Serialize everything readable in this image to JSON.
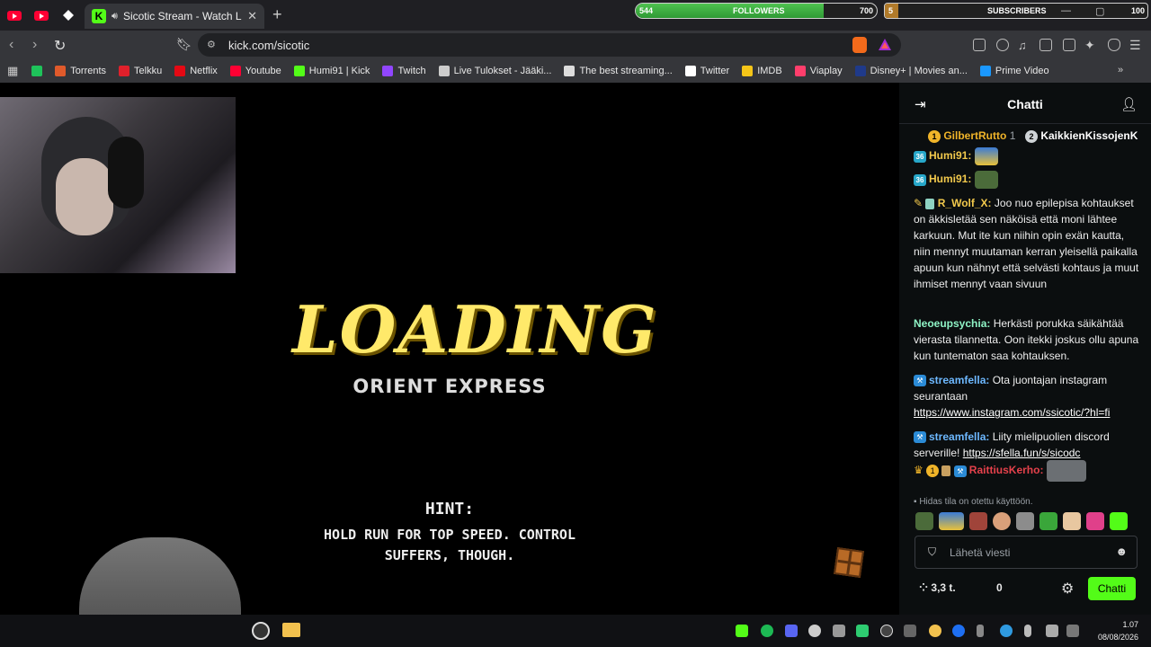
{
  "browser": {
    "active_tab_title": "Sicotic Stream - Watch Live o",
    "url": "kick.com/sicotic"
  },
  "overlays": {
    "followers": {
      "current": "544",
      "label": "FOLLOWERS",
      "goal": "700",
      "progress": 0.78
    },
    "subscribers": {
      "current": "5",
      "label": "SUBSCRIBERS",
      "goal": "100",
      "progress": 0.05
    }
  },
  "bookmarks": [
    {
      "label": "Torrents",
      "color": "#e05a2b"
    },
    {
      "label": "Telkku",
      "color": "#e0202b"
    },
    {
      "label": "Netflix",
      "color": "#e50914"
    },
    {
      "label": "Youtube",
      "color": "#ff0033"
    },
    {
      "label": "Humi91 | Kick",
      "color": "#53fc18"
    },
    {
      "label": "Twitch",
      "color": "#9146ff"
    },
    {
      "label": "Live Tulokset - Jääki...",
      "color": "#cccccc"
    },
    {
      "label": "The best streaming...",
      "color": "#dddddd"
    },
    {
      "label": "Twitter",
      "color": "#ffffff"
    },
    {
      "label": "IMDB",
      "color": "#f5c518"
    },
    {
      "label": "Viaplay",
      "color": "#ff3e6c"
    },
    {
      "label": "Disney+ | Movies an...",
      "color": "#1f3a8a"
    },
    {
      "label": "Prime Video",
      "color": "#1a98ff"
    }
  ],
  "stream": {
    "loading_title": "LOADING",
    "loading_subtitle": "ORIENT EXPRESS",
    "hint_label": "HINT:",
    "hint_line1": "HOLD RUN FOR TOP SPEED. CONTROL",
    "hint_line2": "SUFFERS, THOUGH."
  },
  "chat": {
    "title": "Chatti",
    "leaderboard": [
      {
        "rank": "1",
        "name": "GilbertRutto",
        "count": "1",
        "color": "#f0b429"
      },
      {
        "rank": "2",
        "name": "KaikkienKissojenK",
        "count": "",
        "color": "#cfd3d6"
      }
    ],
    "messages": [
      {
        "badge": "36",
        "user": "Humi91:",
        "user_color": "#f2c94c",
        "text": ""
      },
      {
        "badge": "36",
        "user": "Humi91:",
        "user_color": "#f2c94c",
        "text": ""
      },
      {
        "badge": "",
        "user": "R_Wolf_X:",
        "user_color": "#f2c94c",
        "text": "Joo nuo epilepisa kohtaukset on äkkisletää sen näköisä että moni lähtee karkuun. Mut ite kun niihin opin exän kautta, niin mennyt muutaman kerran yleisellä paikalla apuun kun nähnyt että selvästi kohtaus ja muut ihmiset mennyt vaan sivuun"
      },
      {
        "badge": "",
        "user": "Neoeupsychia:",
        "user_color": "#8ef3c5",
        "text": "Herkästi porukka säikähtää vierasta tilannetta. Oon itekki joskus ollu apuna kun tuntematon saa kohtauksen."
      },
      {
        "badge": "",
        "user": "streamfella:",
        "user_color": "#6db8ff",
        "text": "Ota juontajan instagram seurantaan",
        "link": "https://www.instagram.com/ssicotic/?hl=fi"
      },
      {
        "badge": "",
        "user": "streamfella:",
        "user_color": "#6db8ff",
        "text": "Liity mielipuolien discord serverille!",
        "link": "https://sfella.fun/s/sicodc"
      },
      {
        "badge": "1",
        "user": "RaittiusKerho:",
        "user_color": "#e5414b",
        "text": ""
      }
    ],
    "slow_mode": "Hidas tila on otettu käyttöön.",
    "input_placeholder": "Lähetä viesti",
    "points": "3,3 t.",
    "zero_count": "0",
    "send_label": "Chatti"
  },
  "taskbar": {
    "time": "1.07",
    "date": "08/08/2026"
  }
}
